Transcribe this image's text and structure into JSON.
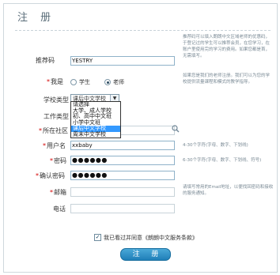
{
  "page": {
    "title": "注 册"
  },
  "form": {
    "referrer": {
      "label": "推荐码",
      "value": "YESTRY",
      "hint": "推荐码可以填入朗朗中文区域老师的优惠码，于登记过的学生可以推荐会员，在您学习，在账户里使用完的学习的费用。如果您都是首，无需填写。"
    },
    "role": {
      "label": "我是",
      "options": [
        "学生",
        "老师"
      ],
      "selected": "老师",
      "hint": "如果您是我们的老师注册。我们可以为您的学校提供流量课程和模式的教学指导。"
    },
    "school_type": {
      "label": "学校类型",
      "value": "课后中文学校",
      "options": [
        "请选择",
        "大学、成人学校",
        "初、高中中文班",
        "小学中文班",
        "课后中文学校",
        "周末中文学校"
      ],
      "highlighted": "课后中文学校"
    },
    "work_type": {
      "label": "工作类型"
    },
    "community": {
      "label": "所在社区"
    },
    "username": {
      "label": "用户名",
      "value": "xxbaby",
      "hint": "4-30个字符(字母、数字、下划线)"
    },
    "password": {
      "label": "密码",
      "value": "●●●●●●",
      "hint": "6-30个字符(字母、数字、下划线、符号)"
    },
    "confirm_password": {
      "label": "确认密码",
      "value": "●●●●●●"
    },
    "email": {
      "label": "邮箱",
      "hint": "请填写常用的Email地址，以便找回密码和接收的服务通知。"
    },
    "phone": {
      "label": "电话"
    },
    "agree_text": "我已看过并同意《朗朗中文服务条款》",
    "submit_label": "注 册"
  },
  "colors": {
    "accent": "#1f7fb8",
    "required": "#d30000",
    "dropdown_highlight": "#3399ff"
  }
}
